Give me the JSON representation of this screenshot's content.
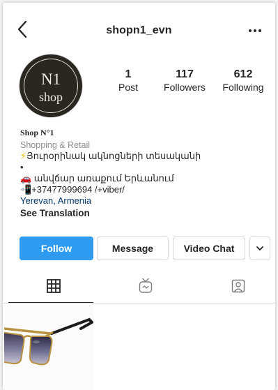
{
  "header": {
    "username": "shopn1_evn",
    "back_icon": "chevron-left-icon",
    "more_icon": "more-horizontal-icon"
  },
  "avatar": {
    "line1": "N1",
    "line2": "shop"
  },
  "stats": [
    {
      "number": "1",
      "label": "Post"
    },
    {
      "number": "117",
      "label": "Followers"
    },
    {
      "number": "612",
      "label": "Following"
    }
  ],
  "bio": {
    "name": "Shop N°1",
    "category": "Shopping & Retail",
    "line1_emoji": "⚡",
    "line1_text": "Յուրօրինակ ակնոցների տեսականի",
    "bullet": "•",
    "line2_emoji": "🚗",
    "line2_text": " անվճար առաքում Երևանում",
    "line3_emoji": "📲",
    "line3_text": "+37477999694 /+viber/",
    "location": "Yerevan, Armenia",
    "see_translation": "See Translation"
  },
  "actions": {
    "follow": "Follow",
    "message": "Message",
    "video_chat": "Video Chat",
    "more_icon": "chevron-down-icon"
  },
  "tabs": [
    {
      "icon": "grid-icon",
      "active": true
    },
    {
      "icon": "igtv-icon",
      "active": false
    },
    {
      "icon": "tagged-icon",
      "active": false
    }
  ],
  "colors": {
    "follow_blue": "#2f9bf0",
    "link_blue": "#00376b",
    "category_gray": "#8e8e8e"
  }
}
